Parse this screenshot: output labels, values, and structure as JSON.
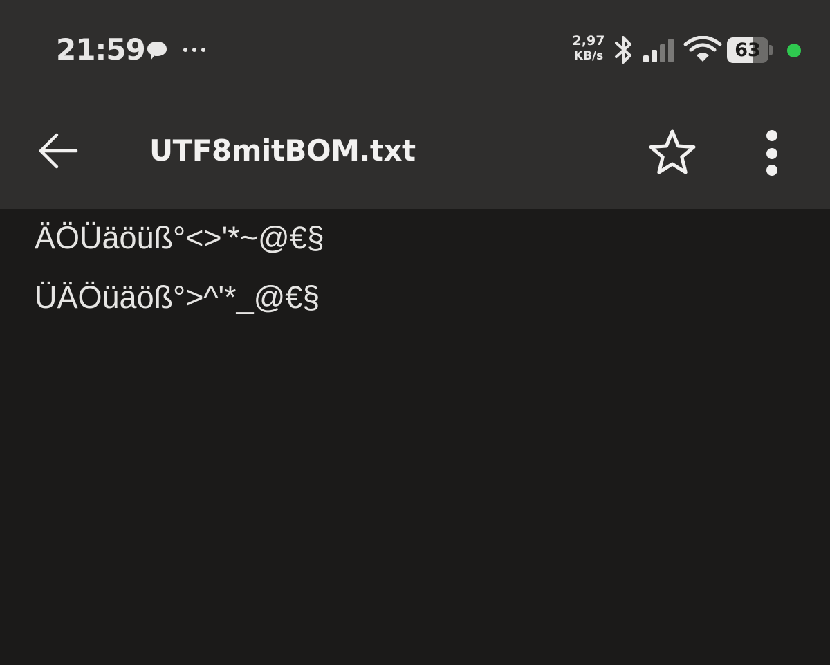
{
  "status_bar": {
    "time": "21:59",
    "notification_icons": [
      "chat-bubble-icon",
      "more-dots-icon"
    ],
    "net_speed_value": "2,97",
    "net_speed_unit": "KB/s",
    "icons": [
      "bluetooth-icon",
      "cellular-signal-icon",
      "wifi-icon"
    ],
    "battery_level": "63",
    "privacy_indicator_color": "#2fc84f"
  },
  "toolbar": {
    "back_icon": "arrow-left-icon",
    "title": "UTF8mitBOM.txt",
    "favorite_icon": "star-outline-icon",
    "menu_icon": "more-vert-icon"
  },
  "document": {
    "lines": [
      "ÄÖÜäöüß°<>'*~@€§",
      "ÜÄÖüäöß°>^'*_@€§"
    ]
  },
  "colors": {
    "header_background": "#2f2e2d",
    "content_background": "#1b1a19",
    "text": "#e6e5e3"
  }
}
